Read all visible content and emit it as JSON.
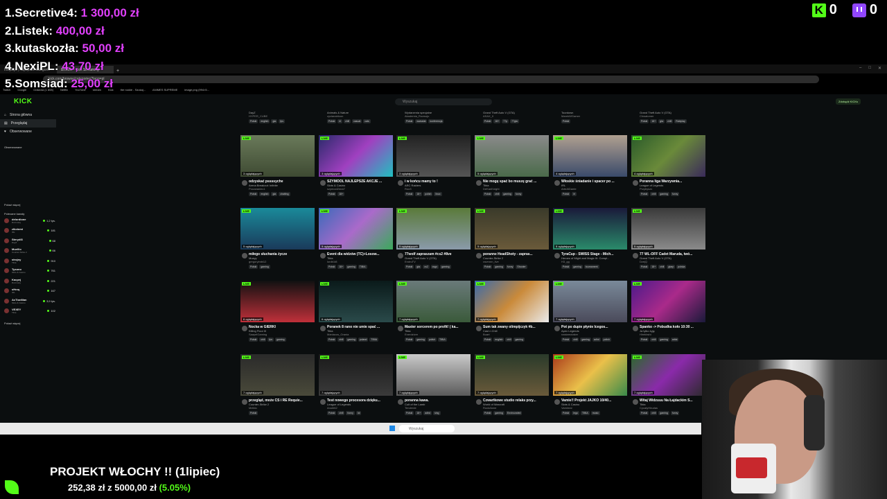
{
  "leaderboard": [
    {
      "rank": "1.",
      "name": "Secretive4:",
      "amount": "1 300,00 zł"
    },
    {
      "rank": "2.",
      "name": "Listek:",
      "amount": "400,00 zł"
    },
    {
      "rank": "3.",
      "name": "kutaskozła:",
      "amount": "50,00 zł"
    },
    {
      "rank": "4.",
      "name": "NexiPL:",
      "amount": "43,70 zł"
    },
    {
      "rank": "5.",
      "name": "Somsiad:",
      "amount": "25,00 zł"
    }
  ],
  "counters": {
    "kick": "0",
    "twitch": "0"
  },
  "browser": {
    "tabs": [
      "Inicjacja | Najlepsze kategorie",
      "Browse - Kick Streaming"
    ],
    "url": "kick.com/browse/categories?lang=pl",
    "bookmarks": [
      "Twitch",
      "Google",
      "Odsłona (1 808)",
      "Netflix",
      "YouTube",
      "stream",
      "Kick",
      "the rookie - Szukaj...",
      "ANIMES SUPREME",
      "image.png (994×5..."
    ]
  },
  "kick": {
    "logo": "KICK",
    "search_placeholder": "Wyszukaj",
    "get_kicks": "Zdobądź KICKs",
    "nav": [
      "Strona główna",
      "Przeglądaj",
      "Obserwowane"
    ],
    "followed_head": "Obserwowane",
    "show_more_1": "Pokaż więcej",
    "recommended_head": "Polecane kanały",
    "show_more_2": "Pokaż więcej",
    "recommended": [
      {
        "name": "delordione",
        "game": "Rozmowy",
        "viewers": "1,2 tys."
      },
      {
        "name": "zikoiomi",
        "game": "IRL",
        "viewers": "181"
      },
      {
        "name": "Sterydi3",
        "game": "DayZ",
        "viewers": "68"
      },
      {
        "name": "Muellio",
        "game": "Counter-Strike 2",
        "viewers": "66"
      },
      {
        "name": "strojny",
        "game": "Tibia",
        "viewers": "910"
      },
      {
        "name": "Tysono",
        "game": "Slots & Casino",
        "viewers": "761"
      },
      {
        "name": "Kacpej",
        "game": "Rozmowy",
        "viewers": "221"
      },
      {
        "name": "sHrzq",
        "game": "IRL",
        "viewers": "167"
      },
      {
        "name": "AcTionMan",
        "game": "Slots & Casino",
        "viewers": "3,9 tys."
      },
      {
        "name": "VEXEY",
        "game": "Tibia",
        "viewers": "102"
      }
    ],
    "top_row": [
      {
        "game": "DayZ",
        "user": "HYPER_CUBE",
        "tags": [
          "Polski",
          "english",
          "gta",
          "fps"
        ]
      },
      {
        "game": "Animals & Nature",
        "user": "zycianabloon",
        "tags": [
          "Polski",
          "irl",
          "chill",
          "casual",
          "cats"
        ]
      },
      {
        "game": "Wydarzenia specjalne",
        "user": "Akademia_Rozwoju",
        "tags": [
          "Polski",
          "warsztat",
          "konferencja"
        ]
      },
      {
        "game": "Grand Theft Auto V (GTA)",
        "user": "ASAX_0",
        "tags": [
          "Polski",
          "18+",
          "77p",
          "77gta"
        ]
      },
      {
        "game": "Toordown",
        "user": "MarekWGamer",
        "tags": [
          "Polski"
        ]
      },
      {
        "game": "Grand Theft Auto V (GTA)",
        "user": "Chwatomer",
        "tags": [
          "Polski",
          "18+",
          "gta",
          "chill",
          "Roleplay"
        ]
      }
    ],
    "cards": [
      {
        "title": "odzyskać pssssyche",
        "game": "Arena Breakout: Infinite",
        "user": "Poczwaniec1",
        "viewers": "3 oglądających",
        "tags": [
          "Polski",
          "english",
          "gta",
          "chatting"
        ],
        "live": "LIVE"
      },
      {
        "title": "SZYMOOL NAJLEPSZE AKCJE ...",
        "game": "Slots & Casino",
        "user": "szymool2nna7",
        "viewers": "3 oglądających",
        "tags": [
          "Polski",
          "18+"
        ],
        "live": "LIVE"
      },
      {
        "title": "i w końcu mamy to !",
        "game": "ARC Raiders",
        "user": "Roo3",
        "viewers": "3 oglądających",
        "tags": [
          "Polski",
          "18+",
          "polish",
          "linux"
        ],
        "live": "LIVE"
      },
      {
        "title": "Nie mogę spać bo muszę grać ...",
        "game": "Tibia",
        "user": "DeKanKnight",
        "viewers": "5 oglądających",
        "tags": [
          "Polski",
          "chill",
          "gaming",
          "funny"
        ],
        "live": "LIVE"
      },
      {
        "title": "Włoskie śniadanie i spacer po ...",
        "game": "IRL",
        "user": "ArteAlDante",
        "viewers": "4 oglądających",
        "tags": [
          "Polski",
          "irl"
        ],
        "live": "LIVE"
      },
      {
        "title": "Poranna liga Warzywnia...",
        "game": "League of Legends",
        "user": "Przybyszx",
        "viewers": "4 oglądających",
        "tags": [
          "Polski",
          "chill",
          "gaming",
          "funny"
        ],
        "live": "LIVE"
      },
      {
        "title": "miłego słuchania życze",
        "game": "Muzyy",
        "user": "gregoryimbi12",
        "viewers": "5 oglądających",
        "tags": [
          "Polski",
          "gaming"
        ],
        "live": "LIVE"
      },
      {
        "title": "Event dla widzów (TC)+Losow...",
        "game": "Tibia",
        "user": "lordb1t8",
        "viewers": "5 oglądających",
        "tags": [
          "Polski",
          "18+",
          "gaming",
          "TIBIA"
        ],
        "live": "LIVE"
      },
      {
        "title": "77wolf zapraszam #cs2 #8ve",
        "game": "Grand Theft Auto V (GTA)",
        "user": "EndruTV",
        "viewers": "5 oglądających",
        "tags": [
          "Polski",
          "gta",
          "cs2",
          "csgo",
          "gaming"
        ],
        "live": "LIVE"
      },
      {
        "title": "poranne HeadShoty - zapras...",
        "game": "Counter-Strike 2",
        "user": "ravennn_live",
        "viewers": "5 oglądających",
        "tags": [
          "Polski",
          "gaming",
          "funny",
          "Shooter"
        ],
        "live": "LIVE"
      },
      {
        "title": "TyraCup - SWISS Stage - Mich...",
        "game": "Heroes of Might and Magic III: Compl...",
        "user": "H3_gg",
        "viewers": "5 oglądających",
        "tags": [
          "Polski",
          "gaming",
          "tournament"
        ],
        "live": "LIVE"
      },
      {
        "title": "77 WL-OFF Cadet Maruda, twó...",
        "game": "Grand Theft Auto V (GTA)",
        "user": "DzejQ",
        "viewers": "5 oglądających",
        "tags": [
          "Polski",
          "18+",
          "chill",
          "gtarp",
          "polska"
        ],
        "live": "LIVE"
      },
      {
        "title": "Nocka w GIERKI",
        "game": "Killing Floor III",
        "user": "SaayelGaming",
        "viewers": "6 oglądających",
        "tags": [
          "Polski",
          "chill",
          "fps",
          "gaming"
        ],
        "live": "LIVE"
      },
      {
        "title": "Poranek 8 rano nie umie spać ...",
        "game": "Tibia",
        "user": "Maniacos_Grania",
        "viewers": "6 oglądających",
        "tags": [
          "Polski",
          "chill",
          "gaming",
          "poland",
          "TIBIA"
        ],
        "live": "LIVE"
      },
      {
        "title": "Master sorcerem po profit! ( ka...",
        "game": "Tibia",
        "user": "Enerdzizer",
        "viewers": "7 oglądających",
        "tags": [
          "Polski",
          "gaming",
          "polish",
          "TIBIA"
        ],
        "live": "LIVE"
      },
      {
        "title": "Sum tak zwany olimpijczyk #b...",
        "game": "Cast n Chill",
        "user": "Buart",
        "viewers": "7 oglądających",
        "tags": [
          "Polski",
          "english",
          "chill",
          "gaming"
        ],
        "live": "LIVE"
      },
      {
        "title": "Pot po dupie płynie  Icegos...",
        "game": "Apex Legends",
        "user": "nastamotaker",
        "viewers": "7 oglądających",
        "tags": [
          "Polski",
          "chill",
          "gaming",
          "adhd",
          "polish"
        ],
        "live": "LIVE"
      },
      {
        "title": "Spanko -> Pobudka koło 10:30 ...",
        "game": "Ja tylko żyję",
        "user": "Hirekbshi",
        "viewers": "7 oglądających",
        "tags": [
          "Polski",
          "chill",
          "gaming",
          "artist"
        ],
        "live": "LIVE"
      },
      {
        "title": "przegląd, może CS i RE Requie...",
        "game": "Counter-Strike 2",
        "user": "Meikto",
        "viewers": "7 oglądających",
        "tags": [
          "Polski"
        ],
        "live": "LIVE"
      },
      {
        "title": "Test nowego procesora dzięku...",
        "game": "League of Legends",
        "user": "Anubi62",
        "viewers": "7 oglądających",
        "tags": [
          "Polski",
          "chill",
          "funny",
          "lol"
        ],
        "live": "LIVE"
      },
      {
        "title": "poranna kawa.",
        "game": "Cult of the Lamb",
        "user": "Tenderde",
        "viewers": "7 oglądających",
        "tags": [
          "Polski",
          "18+",
          "adhd",
          "sing"
        ],
        "live": "LIVE"
      },
      {
        "title": "Czwartkowe studio relaks przy...",
        "game": "World of Warcraft",
        "user": "RockAlone",
        "viewers": "7 oglądających",
        "tags": [
          "Polski",
          "gaming",
          "Envirounded"
        ],
        "live": "LIVE"
      },
      {
        "title": "Vamie!! Projekt JAJKO 10/40...",
        "game": "Slots & Casino",
        "user": "Vamireal",
        "viewers": "7 oglądających",
        "tags": [
          "Polski",
          "lego",
          "TIBIA",
          "music"
        ],
        "live": "LIVE"
      },
      {
        "title": "Witaj Widzuuu Na Łajdackim S...",
        "game": "Tibia",
        "user": "CycatyHirudas",
        "viewers": "7 oglądających",
        "tags": [
          "Polski",
          "chill",
          "gaming",
          "funny"
        ],
        "live": "LIVE"
      }
    ]
  },
  "taskbar": {
    "search": "Wyszukaj"
  },
  "goal": {
    "title": "PROJEKT WŁOCHY !! (1lipiec)",
    "current": "252,38 zł",
    "sep": "z",
    "target": "5000,00 zł",
    "percent": "(5.05%)"
  },
  "colors": {
    "kick_green": "#53fc18",
    "leader_amount": "#e040fb",
    "twitch_purple": "#9146ff"
  }
}
